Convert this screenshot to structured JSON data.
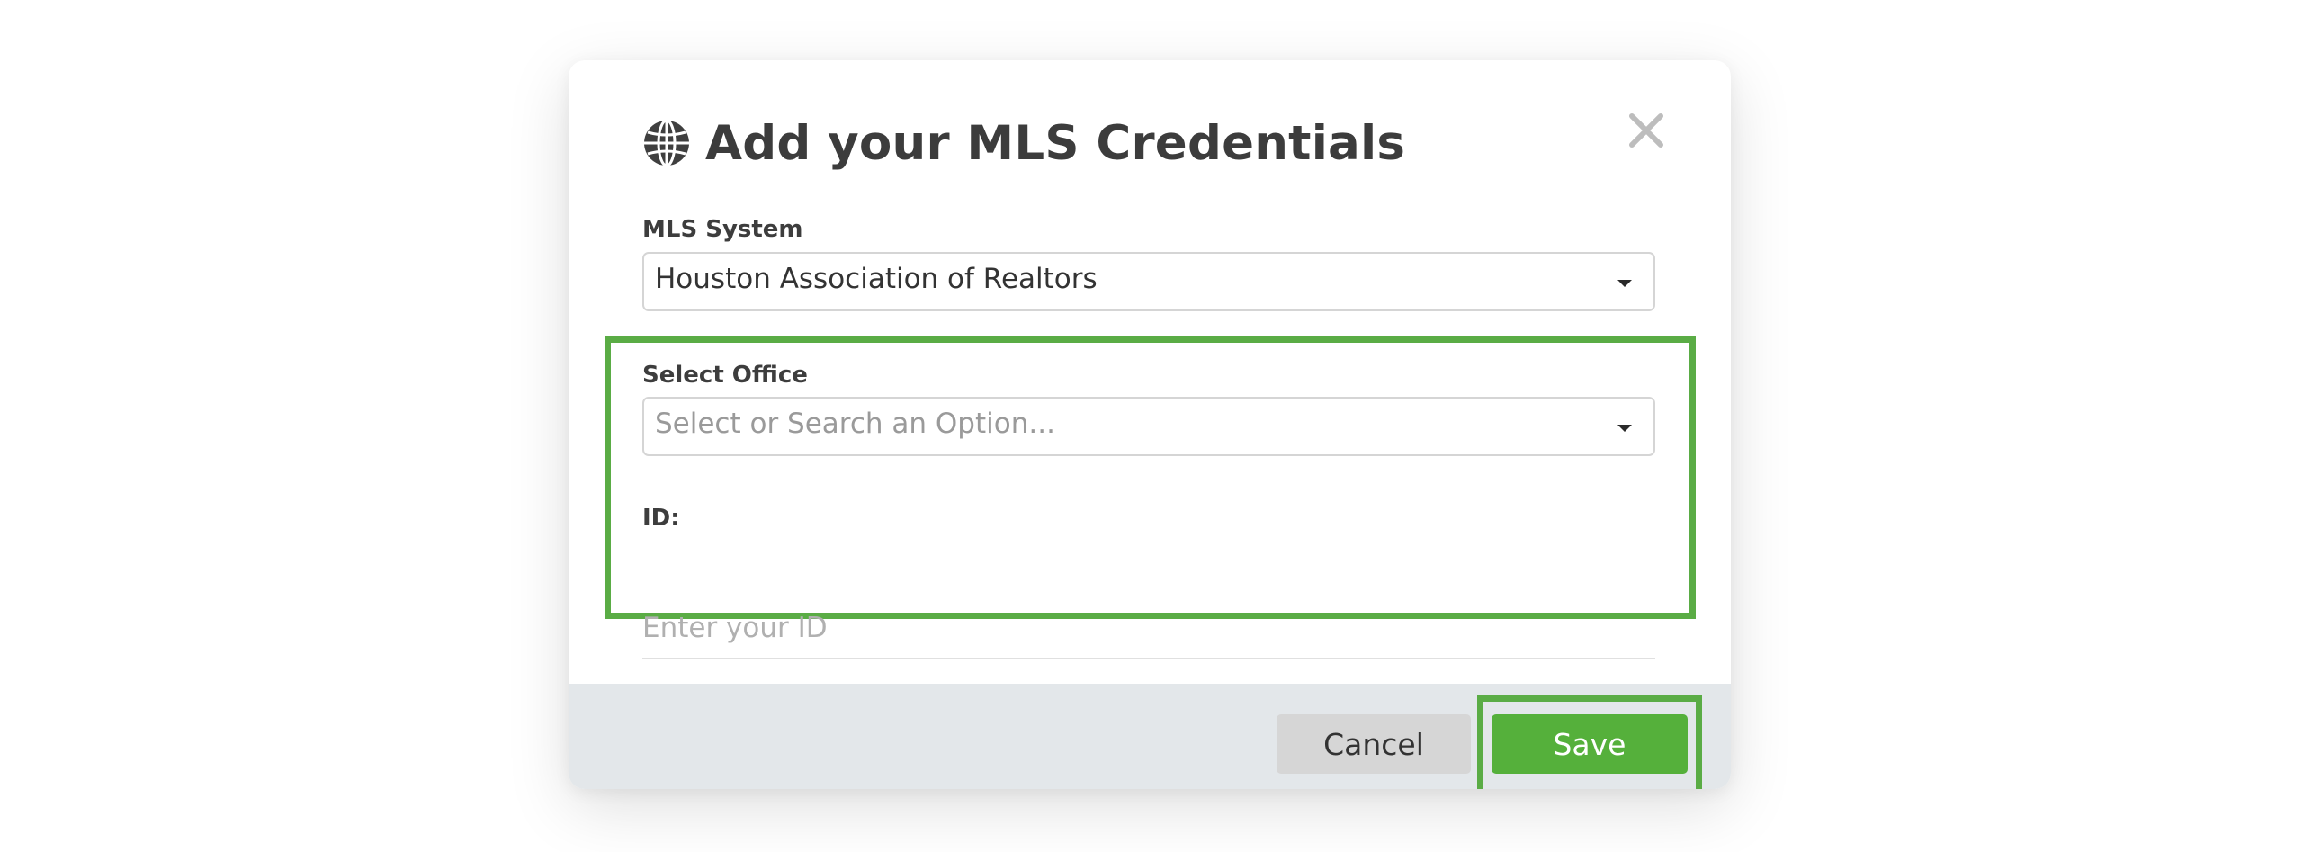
{
  "modal": {
    "title": "Add your MLS Credentials",
    "title_icon": "globe-icon",
    "close_icon": "close-icon"
  },
  "fields": {
    "mls_system": {
      "label": "MLS System",
      "value": "Houston Association of Realtors"
    },
    "office": {
      "label": "Select Office",
      "placeholder": "Select or Search an Option..."
    },
    "id": {
      "label": "ID:",
      "placeholder": "Enter your ID",
      "value": ""
    }
  },
  "footer": {
    "cancel_label": "Cancel",
    "save_label": "Save"
  },
  "colors": {
    "highlight": "#5aac45",
    "save_button": "#55b03b",
    "footer_bg": "#e3e7ea",
    "title_text": "#3c3c3c"
  }
}
